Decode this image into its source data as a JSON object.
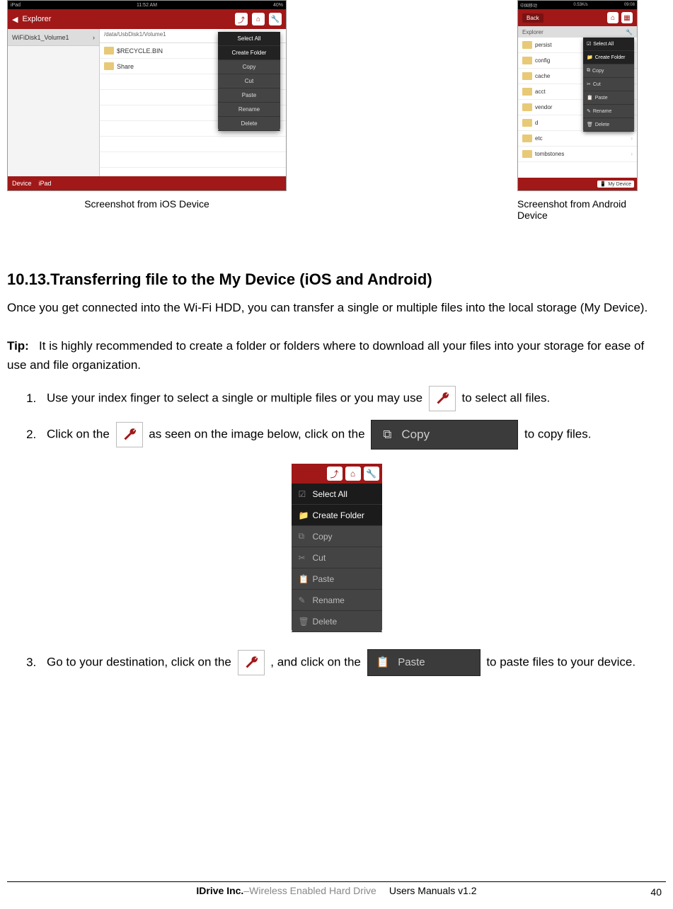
{
  "captions": {
    "ios": "Screenshot from iOS Device",
    "android": "Screenshot from Android Device"
  },
  "ios": {
    "status_left": "iPad",
    "status_time": "11:52 AM",
    "status_right": "40%",
    "explorer_title": "Explorer",
    "sidebar_item": "WiFiDisk1_Volume1",
    "breadcrumb": "/data/UsbDisk1/Volume1",
    "files": [
      "$RECYCLE.BIN",
      "Share"
    ],
    "bottom_left": "Device",
    "bottom_right": "iPad",
    "menu": [
      "Select All",
      "Create Folder",
      "Copy",
      "Cut",
      "Paste",
      "Rename",
      "Delete"
    ]
  },
  "android": {
    "status_left": "中国移动",
    "status_mid": "0.53K/s",
    "status_right": "09:08",
    "back": "Back",
    "grey_left": "Explorer",
    "folders": [
      "persist",
      "config",
      "cache",
      "acct",
      "vendor",
      "d",
      "etc",
      "tombstones"
    ],
    "menu": [
      "Select All",
      "Create Folder",
      "Copy",
      "Cut",
      "Paste",
      "Rename",
      "Delete"
    ],
    "bottom_btn": "My Device"
  },
  "section": {
    "heading": "10.13.Transferring file to the My Device (iOS and Android)",
    "intro": "Once you get connected into the Wi-Fi HDD, you can transfer a single or multiple files into the local storage (My Device).",
    "tip_label": "Tip:",
    "tip_text": "It is highly recommended to create a folder or folders where to download all your files into your storage for ease of use and file organization.",
    "step1_a": "Use your index finger to select a single or multiple files or you may use ",
    "step1_b": " to select all files.",
    "step2_a": "Click on the ",
    "step2_b": " as seen on the image below, click on the ",
    "step2_c": " to copy files.",
    "copy_label": "Copy",
    "step3_a": "Go to your destination, click on the ",
    "step3_b": ", and click on the ",
    "step3_c": " to paste files to your device.",
    "paste_label": "Paste"
  },
  "center_menu": [
    "Select All",
    "Create Folder",
    "Copy",
    "Cut",
    "Paste",
    "Rename",
    "Delete"
  ],
  "footer": {
    "company": "IDrive Inc.",
    "product": "–Wireless Enabled Hard Drive",
    "manual": "Users Manuals v1.2",
    "page": "40"
  }
}
